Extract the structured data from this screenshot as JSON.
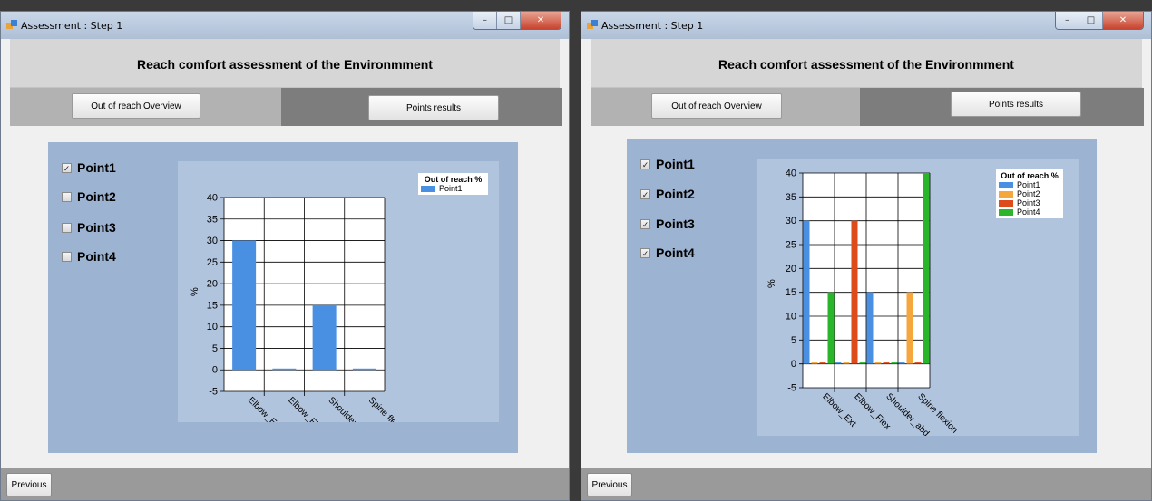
{
  "windows": [
    {
      "title": "Assessment : Step 1",
      "header_title": "Reach comfort assessment of the Environmment",
      "tab_overview": "Out of reach Overview",
      "tab_points": "Points results",
      "checkboxes": [
        {
          "label": "Point1",
          "checked": true
        },
        {
          "label": "Point2",
          "checked": false
        },
        {
          "label": "Point3",
          "checked": false
        },
        {
          "label": "Point4",
          "checked": false
        }
      ],
      "previous_label": "Previous",
      "legend_title": "Out of reach %",
      "legend_items": [
        {
          "label": "Point1",
          "color": "#4a90e2"
        }
      ]
    },
    {
      "title": "Assessment : Step 1",
      "header_title": "Reach comfort assessment of the Environmment",
      "tab_overview": "Out of reach Overview",
      "tab_points": "Points results",
      "checkboxes": [
        {
          "label": "Point1",
          "checked": true
        },
        {
          "label": "Point2",
          "checked": true
        },
        {
          "label": "Point3",
          "checked": true
        },
        {
          "label": "Point4",
          "checked": true
        }
      ],
      "previous_label": "Previous",
      "legend_title": "Out of reach %",
      "legend_items": [
        {
          "label": "Point1",
          "color": "#4a90e2"
        },
        {
          "label": "Point2",
          "color": "#f5a73d"
        },
        {
          "label": "Point3",
          "color": "#dd4b1a"
        },
        {
          "label": "Point4",
          "color": "#2bb52b"
        }
      ]
    }
  ],
  "chart_data": [
    {
      "type": "bar",
      "categories": [
        "Elbow_Ext",
        "Elbow_Flex",
        "Shoulder_abd",
        "Spine flexion"
      ],
      "series": [
        {
          "name": "Point1",
          "values": [
            30,
            0.3,
            15,
            0.3
          ],
          "color": "#4a90e2"
        }
      ],
      "ylabel": "%",
      "ylim": [
        -5,
        40
      ],
      "yticks": [
        40,
        35,
        30,
        25,
        20,
        15,
        10,
        5,
        0,
        -5
      ],
      "grid": true,
      "legend_title": "Out of reach %",
      "legend_position": "top-right"
    },
    {
      "type": "bar",
      "categories": [
        "Elbow_Ext",
        "Elbow_Flex",
        "Shoulder_abd",
        "Spine flexion"
      ],
      "series": [
        {
          "name": "Point1",
          "values": [
            30,
            0.3,
            15,
            0.3
          ],
          "color": "#4a90e2"
        },
        {
          "name": "Point2",
          "values": [
            0.3,
            0.3,
            0.3,
            15
          ],
          "color": "#f5a73d"
        },
        {
          "name": "Point3",
          "values": [
            0.3,
            30,
            0.3,
            0.3
          ],
          "color": "#dd4b1a"
        },
        {
          "name": "Point4",
          "values": [
            15,
            0.3,
            0.3,
            40
          ],
          "color": "#2bb52b"
        }
      ],
      "ylabel": "%",
      "ylim": [
        -5,
        40
      ],
      "yticks": [
        40,
        35,
        30,
        25,
        20,
        15,
        10,
        5,
        0,
        -5
      ],
      "grid": true,
      "legend_title": "Out of reach %",
      "legend_position": "top-right"
    }
  ]
}
